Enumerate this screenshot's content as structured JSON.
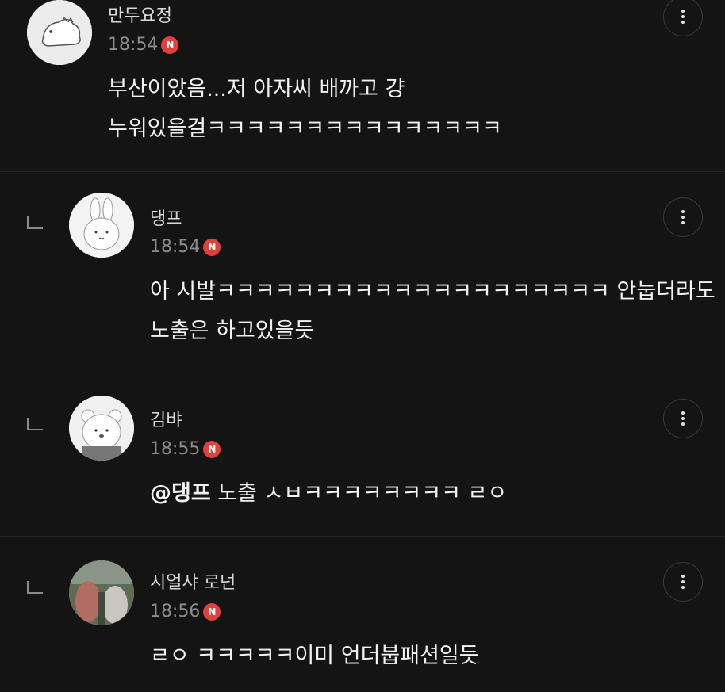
{
  "comments": [
    {
      "nickname": "만두요정",
      "time": "18:54",
      "badge": "N",
      "lines": [
        "부산이았음...저 아자씨 배까고 걍",
        "누워있을걸ㅋㅋㅋㅋㅋㅋㅋㅋㅋㅋㅋㅋㅋㅋㅋ"
      ],
      "avatar": "dino-avatar",
      "is_reply": false
    },
    {
      "nickname": "댕프",
      "time": "18:54",
      "badge": "N",
      "lines": [
        "아 시발ㅋㅋㅋㅋㅋㅋㅋㅋㅋㅋㅋㅋㅋㅋㅋㅋㅋㅋㅋㅋ 안눕더라도",
        "노출은 하고있을듯"
      ],
      "avatar": "rabbit-avatar",
      "is_reply": true
    },
    {
      "nickname": "김뱌",
      "time": "18:55",
      "badge": "N",
      "mention": "@댕프",
      "text": " 노출 ㅅㅂㅋㅋㅋㅋㅋㅋㅋㅋ ㄹㅇ",
      "avatar": "bear-avatar",
      "is_reply": true
    },
    {
      "nickname": "시얼샤 로넌",
      "time": "18:56",
      "badge": "N",
      "lines": [
        "ㄹㅇ ㅋㅋㅋㅋㅋ이미 언더붑패션일듯"
      ],
      "avatar": "photo-avatar",
      "is_reply": true
    }
  ],
  "icons": {
    "more": "more-vertical-icon",
    "reply": "reply-arrow-icon",
    "badge": "new-badge-icon"
  },
  "colors": {
    "background": "#141414",
    "badge": "#e0413c",
    "time": "#8c8c8c"
  }
}
